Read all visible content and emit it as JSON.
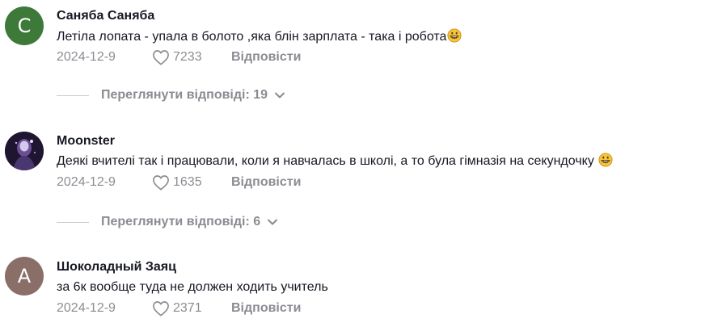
{
  "comments": [
    {
      "avatar_letter": "С",
      "avatar_color": "#3d7a3a",
      "author": "Саняба Саняба",
      "text": "Летіла лопата - упала в болото ,яка блін зарплата - така і робота",
      "emoji": "grinning-face",
      "date": "2024-12-9",
      "likes": "7233",
      "reply_label": "Відповісти",
      "view_replies": "Переглянути відповіді: 19"
    },
    {
      "avatar_letter": "",
      "avatar_color": "#2a1f3d",
      "author": "Moonster",
      "text": "Деякі вчителі так і працювали, коли я навчалась в школі, а то була гімназія на секундочку",
      "emoji": "grinning-face",
      "date": "2024-12-9",
      "likes": "1635",
      "reply_label": "Відповісти",
      "view_replies": "Переглянути відповіді: 6"
    },
    {
      "avatar_letter": "А",
      "avatar_color": "#8a6f68",
      "author": "Шоколадный Заяц",
      "text": "за 6к вообще туда не должен ходить учитель",
      "emoji": "",
      "date": "2024-12-9",
      "likes": "2371",
      "reply_label": "Відповісти"
    }
  ],
  "colors": {
    "text": "#161823",
    "muted": "#8a8b91"
  }
}
